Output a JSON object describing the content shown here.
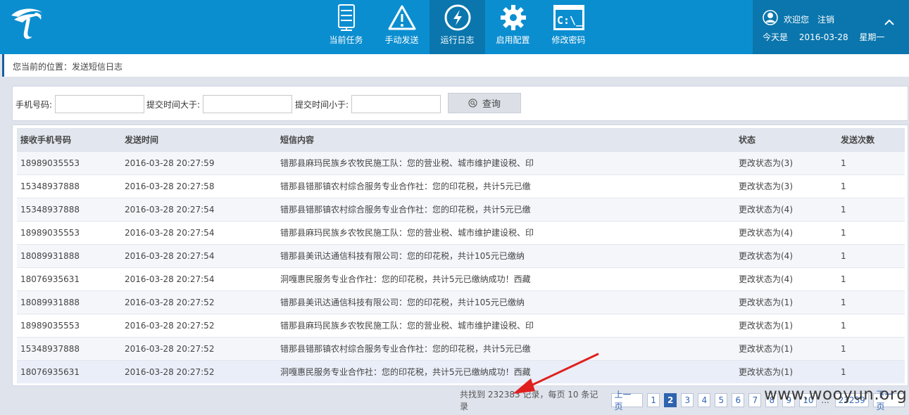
{
  "header": {
    "logo_icon": "china-telecom-logo",
    "nav": [
      {
        "label": "当前任务",
        "icon": "server-icon",
        "active": false
      },
      {
        "label": "手动发送",
        "icon": "warning-icon",
        "active": false
      },
      {
        "label": "运行日志",
        "icon": "log-icon",
        "active": true
      },
      {
        "label": "启用配置",
        "icon": "gear-icon",
        "active": false
      },
      {
        "label": "修改密码",
        "icon": "console-icon",
        "active": false
      }
    ],
    "user": {
      "welcome": "欢迎您",
      "logout": "注销",
      "today_label": "今天是",
      "date": "2016-03-28",
      "weekday": "星期一"
    }
  },
  "breadcrumb": "您当前的位置：发送短信日志",
  "search": {
    "phone_label": "手机号码:",
    "phone_value": "",
    "time_gt_label": "提交时间大于:",
    "time_gt_value": "",
    "time_lt_label": "提交时间小于:",
    "time_lt_value": "",
    "query_label": "查询"
  },
  "table": {
    "columns": [
      "接收手机号码",
      "发送时间",
      "短信内容",
      "状态",
      "发送次数"
    ],
    "rows": [
      [
        "18989035553",
        "2016-03-28 20:27:59",
        "错那县麻玛民族乡农牧民施工队：您的营业税、城市维护建设税、印",
        "更改状态为(3)",
        "1"
      ],
      [
        "15348937888",
        "2016-03-28 20:27:58",
        "错那县错那镇农村综合服务专业合作社：您的印花税，共计5元已缴",
        "更改状态为(3)",
        "1"
      ],
      [
        "15348937888",
        "2016-03-28 20:27:54",
        "错那县错那镇农村综合服务专业合作社：您的印花税，共计5元已缴",
        "更改状态为(4)",
        "1"
      ],
      [
        "18989035553",
        "2016-03-28 20:27:54",
        "错那县麻玛民族乡农牧民施工队：您的营业税、城市维护建设税、印",
        "更改状态为(4)",
        "1"
      ],
      [
        "18089931888",
        "2016-03-28 20:27:54",
        "错那县美讯达通信科技有限公司：您的印花税，共计105元已缴纳",
        "更改状态为(4)",
        "1"
      ],
      [
        "18076935631",
        "2016-03-28 20:27:54",
        "洞嘎惠民服务专业合作社：您的印花税，共计5元已缴纳成功！西藏",
        "更改状态为(4)",
        "1"
      ],
      [
        "18089931888",
        "2016-03-28 20:27:52",
        "错那县美讯达通信科技有限公司：您的印花税，共计105元已缴纳",
        "更改状态为(1)",
        "1"
      ],
      [
        "18989035553",
        "2016-03-28 20:27:52",
        "错那县麻玛民族乡农牧民施工队：您的营业税、城市维护建设税、印",
        "更改状态为(1)",
        "1"
      ],
      [
        "15348937888",
        "2016-03-28 20:27:52",
        "错那县错那镇农村综合服务专业合作社：您的印花税，共计5元已缴",
        "更改状态为(1)",
        "1"
      ],
      [
        "18076935631",
        "2016-03-28 20:27:52",
        "洞嘎惠民服务专业合作社：您的印花税，共计5元已缴纳成功！西藏",
        "更改状态为(1)",
        "1"
      ]
    ]
  },
  "pager": {
    "summary": "共找到 232383 记录，每页 10 条记录",
    "prev": "上一页",
    "pages": [
      "1",
      "2",
      "3",
      "4",
      "5",
      "6",
      "7",
      "8",
      "9",
      "10"
    ],
    "current": "2",
    "ellipsis": "...",
    "last_page": "23239",
    "next": "下一页"
  },
  "watermark": "www.wooyun.org",
  "colors": {
    "header": "#0b8ed0",
    "header_active": "#0a76ad",
    "page_current": "#2e64ae",
    "annotation_arrow": "#e0201e"
  }
}
